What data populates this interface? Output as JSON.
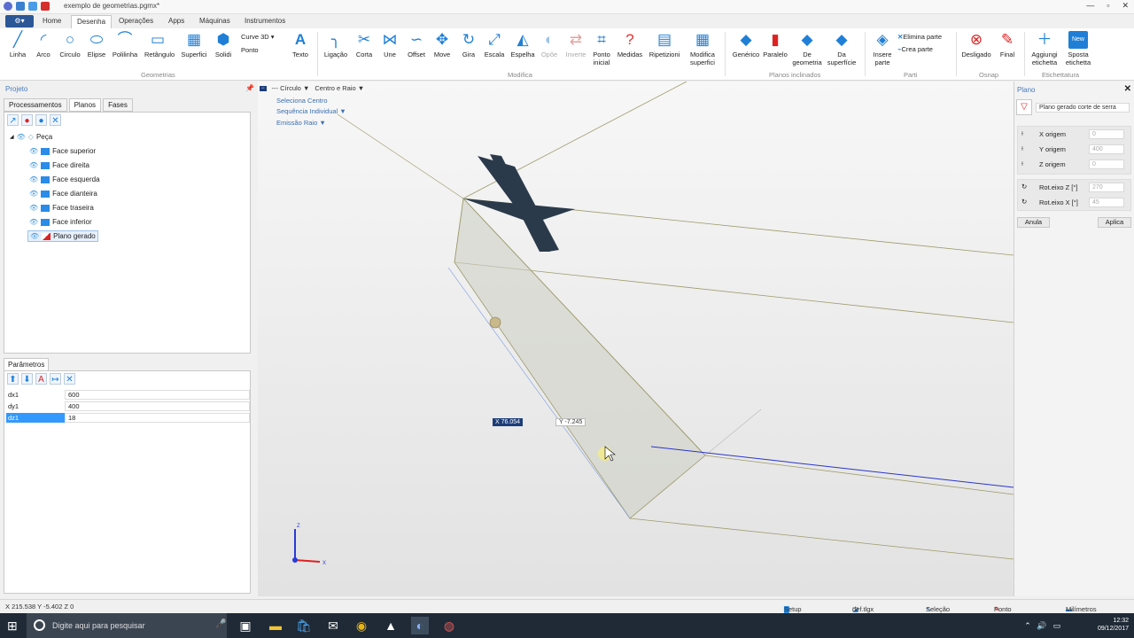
{
  "window": {
    "title": "exemplo de geometrias.pgmx*",
    "controls": [
      "—",
      "▫",
      "✕"
    ]
  },
  "tabs": {
    "app_menu": "⚙▾",
    "items": [
      "Home",
      "Desenha",
      "Operações",
      "Apps",
      "Máquinas",
      "Instrumentos"
    ],
    "active": "Desenha"
  },
  "ribbon": {
    "geometrias": {
      "title": "Geometrias",
      "buttons": [
        "Linha",
        "Arco",
        "Circulo",
        "Elipse",
        "Polilinha",
        "Retângulo",
        "Superfici",
        "Solidi",
        "Texto"
      ],
      "small": [
        "Curve 3D ▾",
        "Ponto"
      ]
    },
    "modifica": {
      "title": "Modifica",
      "buttons": [
        "Ligação",
        "Corta",
        "Une",
        "Offset",
        "Move",
        "Gira",
        "Escala",
        "Espelha",
        "Opõe",
        "Inverte",
        "Ponto inicial",
        "Medidas",
        "Ripetizioni",
        "Modifica superfici"
      ]
    },
    "planos": {
      "title": "Planos inclinados",
      "buttons": [
        "Genérico",
        "Paralelo",
        "De geometria",
        "Da superfície"
      ]
    },
    "parti": {
      "title": "Parti",
      "buttons": [
        "Insere parte"
      ],
      "small": [
        "Elimina parte",
        "Crea parte"
      ]
    },
    "osnap": {
      "title": "Osnap",
      "buttons": [
        "Desligado",
        "Final"
      ]
    },
    "etichettatura": {
      "title": "Etichettatura",
      "buttons": [
        "Aggiungi etichetta",
        "Sposta etichetta"
      ],
      "badge": "New"
    }
  },
  "left": {
    "title": "Projeto",
    "tabs": [
      "Processamentos",
      "Planos",
      "Fases"
    ],
    "active_tab": "Planos",
    "tree": {
      "root": "Peça",
      "items": [
        "Face superior",
        "Face direita",
        "Face esquerda",
        "Face dianteira",
        "Face traseira",
        "Face inferior",
        "Plano gerado"
      ],
      "selected": "Plano gerado"
    },
    "params": {
      "title": "Parâmetros",
      "rows": [
        {
          "name": "dx1",
          "value": "600"
        },
        {
          "name": "dy1",
          "value": "400"
        },
        {
          "name": "dz1",
          "value": "18"
        }
      ]
    }
  },
  "viewport": {
    "menu": [
      "Círculo",
      "Centro e Raio"
    ],
    "links": [
      "Seleciona Centro",
      "Sequência Individual",
      "Emissão Raio"
    ],
    "coord_x": "X 76.054",
    "coord_y": "Y -7.245"
  },
  "right": {
    "title": "Plano",
    "name_field": "Plano gerado corte de serra",
    "fields": [
      {
        "label": "X origem",
        "value": "0"
      },
      {
        "label": "Y origem",
        "value": "400"
      },
      {
        "label": "Z origem",
        "value": "0"
      },
      {
        "label": "Rot.eixo Z [°]",
        "value": "270"
      },
      {
        "label": "Rot.eixo X [°]",
        "value": "45"
      }
    ],
    "cancel": "Anula",
    "apply": "Aplica"
  },
  "status": {
    "coords": "X  215.538     Y  -5.402     Z  0",
    "setup": "Setup",
    "file": "def.tlgx",
    "selection": "Seleção",
    "endpoint": "Ponto final",
    "units": "Milímetros"
  },
  "taskbar": {
    "search": "Digite aqui para pesquisar",
    "time": "12:32",
    "date": "09/12/2017"
  },
  "colors": {
    "accent": "#1f7fd6",
    "selection": "#3399ff",
    "taskbar": "#1f2a36"
  }
}
